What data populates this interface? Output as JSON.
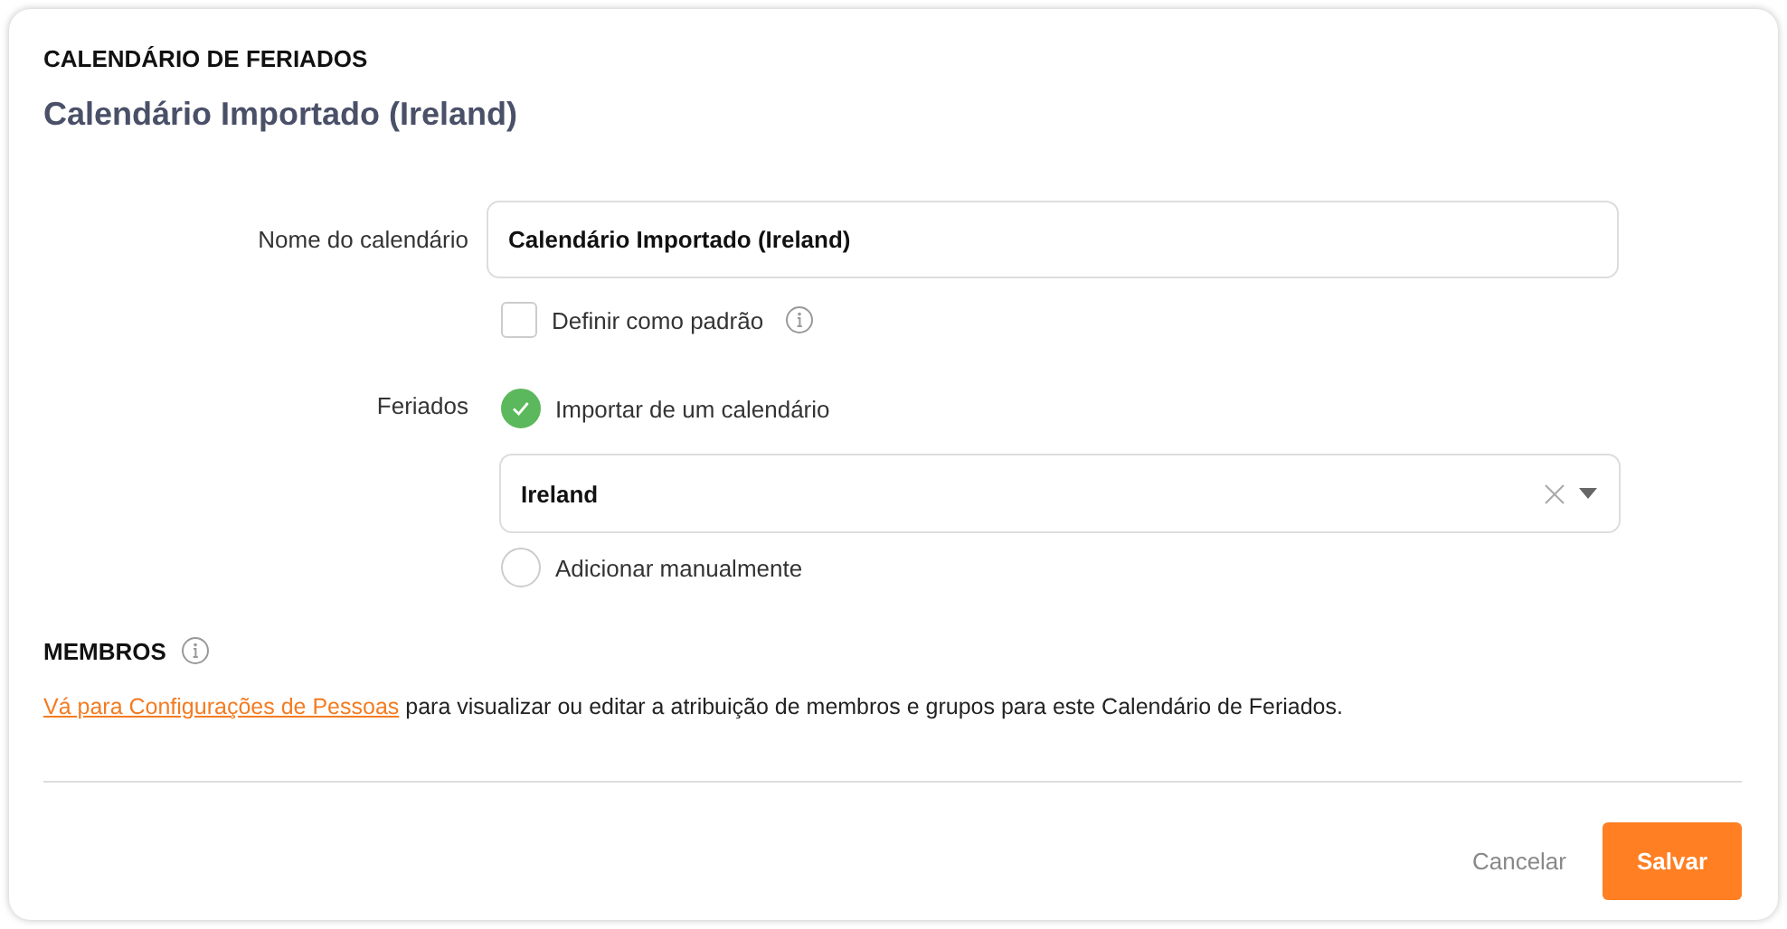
{
  "section_title": "CALENDÁRIO DE FERIADOS",
  "calendar_title": "Calendário Importado (Ireland)",
  "name_field": {
    "label": "Nome do calendário",
    "value": "Calendário Importado (Ireland)"
  },
  "default_checkbox": {
    "label": "Definir como padrão",
    "checked": false
  },
  "holidays": {
    "label": "Feriados",
    "options": [
      {
        "label": "Importar de um calendário",
        "selected": true
      },
      {
        "label": "Adicionar manualmente",
        "selected": false
      }
    ],
    "country_select": {
      "value": "Ireland"
    }
  },
  "members": {
    "title": "MEMBROS",
    "link": "Vá para Configurações de Pessoas",
    "text": " para visualizar ou editar a atribuição de membros e grupos para este Calendário de Feriados."
  },
  "buttons": {
    "cancel": "Cancelar",
    "save": "Salvar"
  }
}
